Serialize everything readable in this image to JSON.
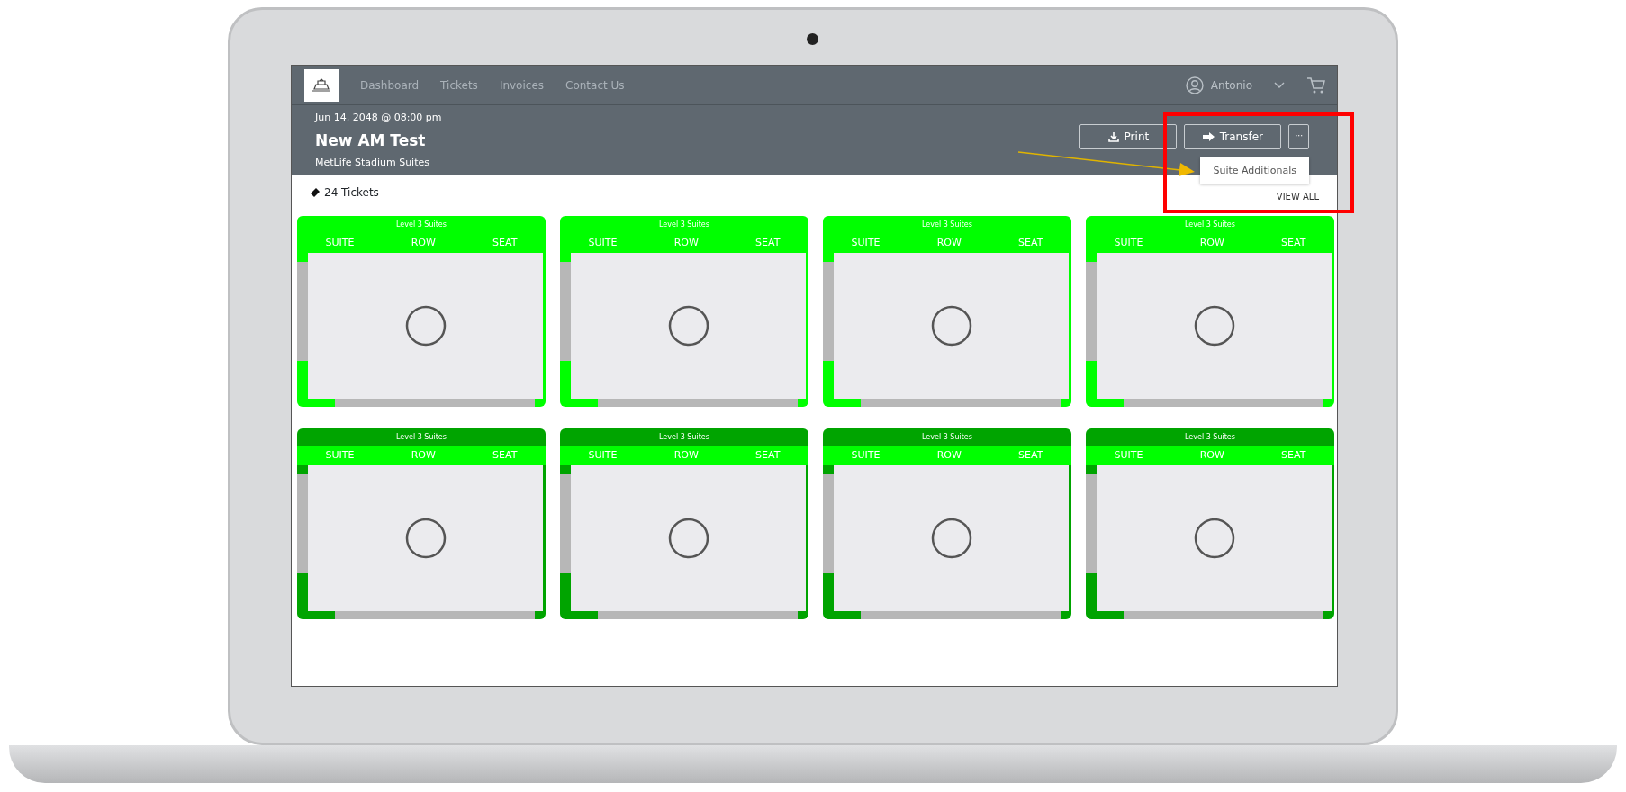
{
  "nav": {
    "items": [
      {
        "label": "Dashboard",
        "selected": false
      },
      {
        "label": "Tickets",
        "selected": false
      },
      {
        "label": "Invoices",
        "selected": false
      },
      {
        "label": "Contact Us",
        "selected": false
      }
    ],
    "user": "Antonio"
  },
  "event": {
    "date": "Jun 14, 2048 @ 08:00 pm",
    "title": "New AM Test",
    "venue": "MetLife Stadium Suites"
  },
  "actions": [
    "Print",
    "Transfer"
  ],
  "more_button": "···",
  "menu": {
    "items": [
      "Suite Additionals"
    ]
  },
  "tickets_count": "24 Tickets",
  "view_all": "VIEW ALL",
  "tickets": [
    {
      "title": "Level 3 Suites",
      "color": "#00ff00",
      "labels": [
        "SUITE",
        "ROW",
        "SEAT"
      ]
    },
    {
      "title": "Level 3 Suites",
      "color": "#00ff00",
      "labels": [
        "SUITE",
        "ROW",
        "SEAT"
      ]
    },
    {
      "title": "Level 3 Suites",
      "color": "#00ff00",
      "labels": [
        "SUITE",
        "ROW",
        "SEAT"
      ]
    },
    {
      "title": "Level 3 Suites",
      "color": "#00ff00",
      "labels": [
        "SUITE",
        "ROW",
        "SEAT"
      ]
    },
    {
      "title": "Level 3 Suites",
      "color": "#00a400",
      "labels": [
        "SUITE",
        "ROW",
        "SEAT"
      ]
    },
    {
      "title": "Level 3 Suites",
      "color": "#00a400",
      "labels": [
        "SUITE",
        "ROW",
        "SEAT"
      ]
    },
    {
      "title": "Level 3 Suites",
      "color": "#00a400",
      "labels": [
        "SUITE",
        "ROW",
        "SEAT"
      ]
    },
    {
      "title": "Level 3 Suites",
      "color": "#00a400",
      "labels": [
        "SUITE",
        "ROW",
        "SEAT"
      ]
    }
  ]
}
